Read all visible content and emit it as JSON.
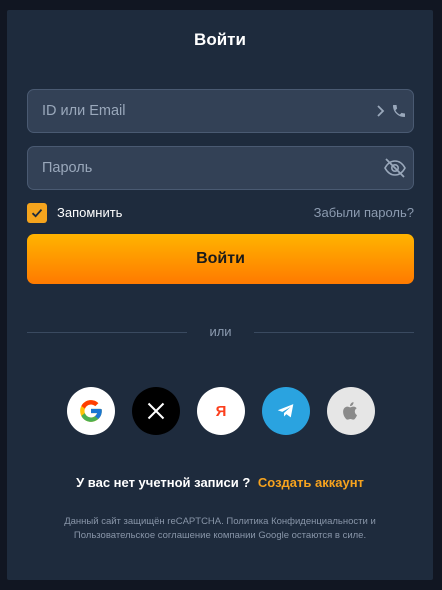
{
  "login": {
    "title": "Войти",
    "id_placeholder": "ID или Email",
    "password_placeholder": "Пароль",
    "remember_label": "Запомнить",
    "remember_checked": true,
    "forgot_link": "Забыли пароль?",
    "submit_label": "Войти",
    "divider_label": "или"
  },
  "socials": [
    "google-icon",
    "x-icon",
    "yandex-icon",
    "telegram-icon",
    "apple-icon"
  ],
  "yandex_glyph": "Я",
  "signup": {
    "question": "У вас нет учетной записи ?",
    "create_link": "Создать аккаунт"
  },
  "legal": "Данный сайт защищён reCAPTCHA. Политика Конфиденциальности и Пользовательское соглашение компании Google остаются в силе.",
  "colors": {
    "page_bg": "#111622",
    "panel_bg": "#1e2b3d",
    "field_bg": "#334156",
    "accent": "#f7a31e",
    "button_gradient_top": "#ffb400",
    "button_gradient_bottom": "#ff7a00",
    "telegram": "#2aa3e0"
  }
}
